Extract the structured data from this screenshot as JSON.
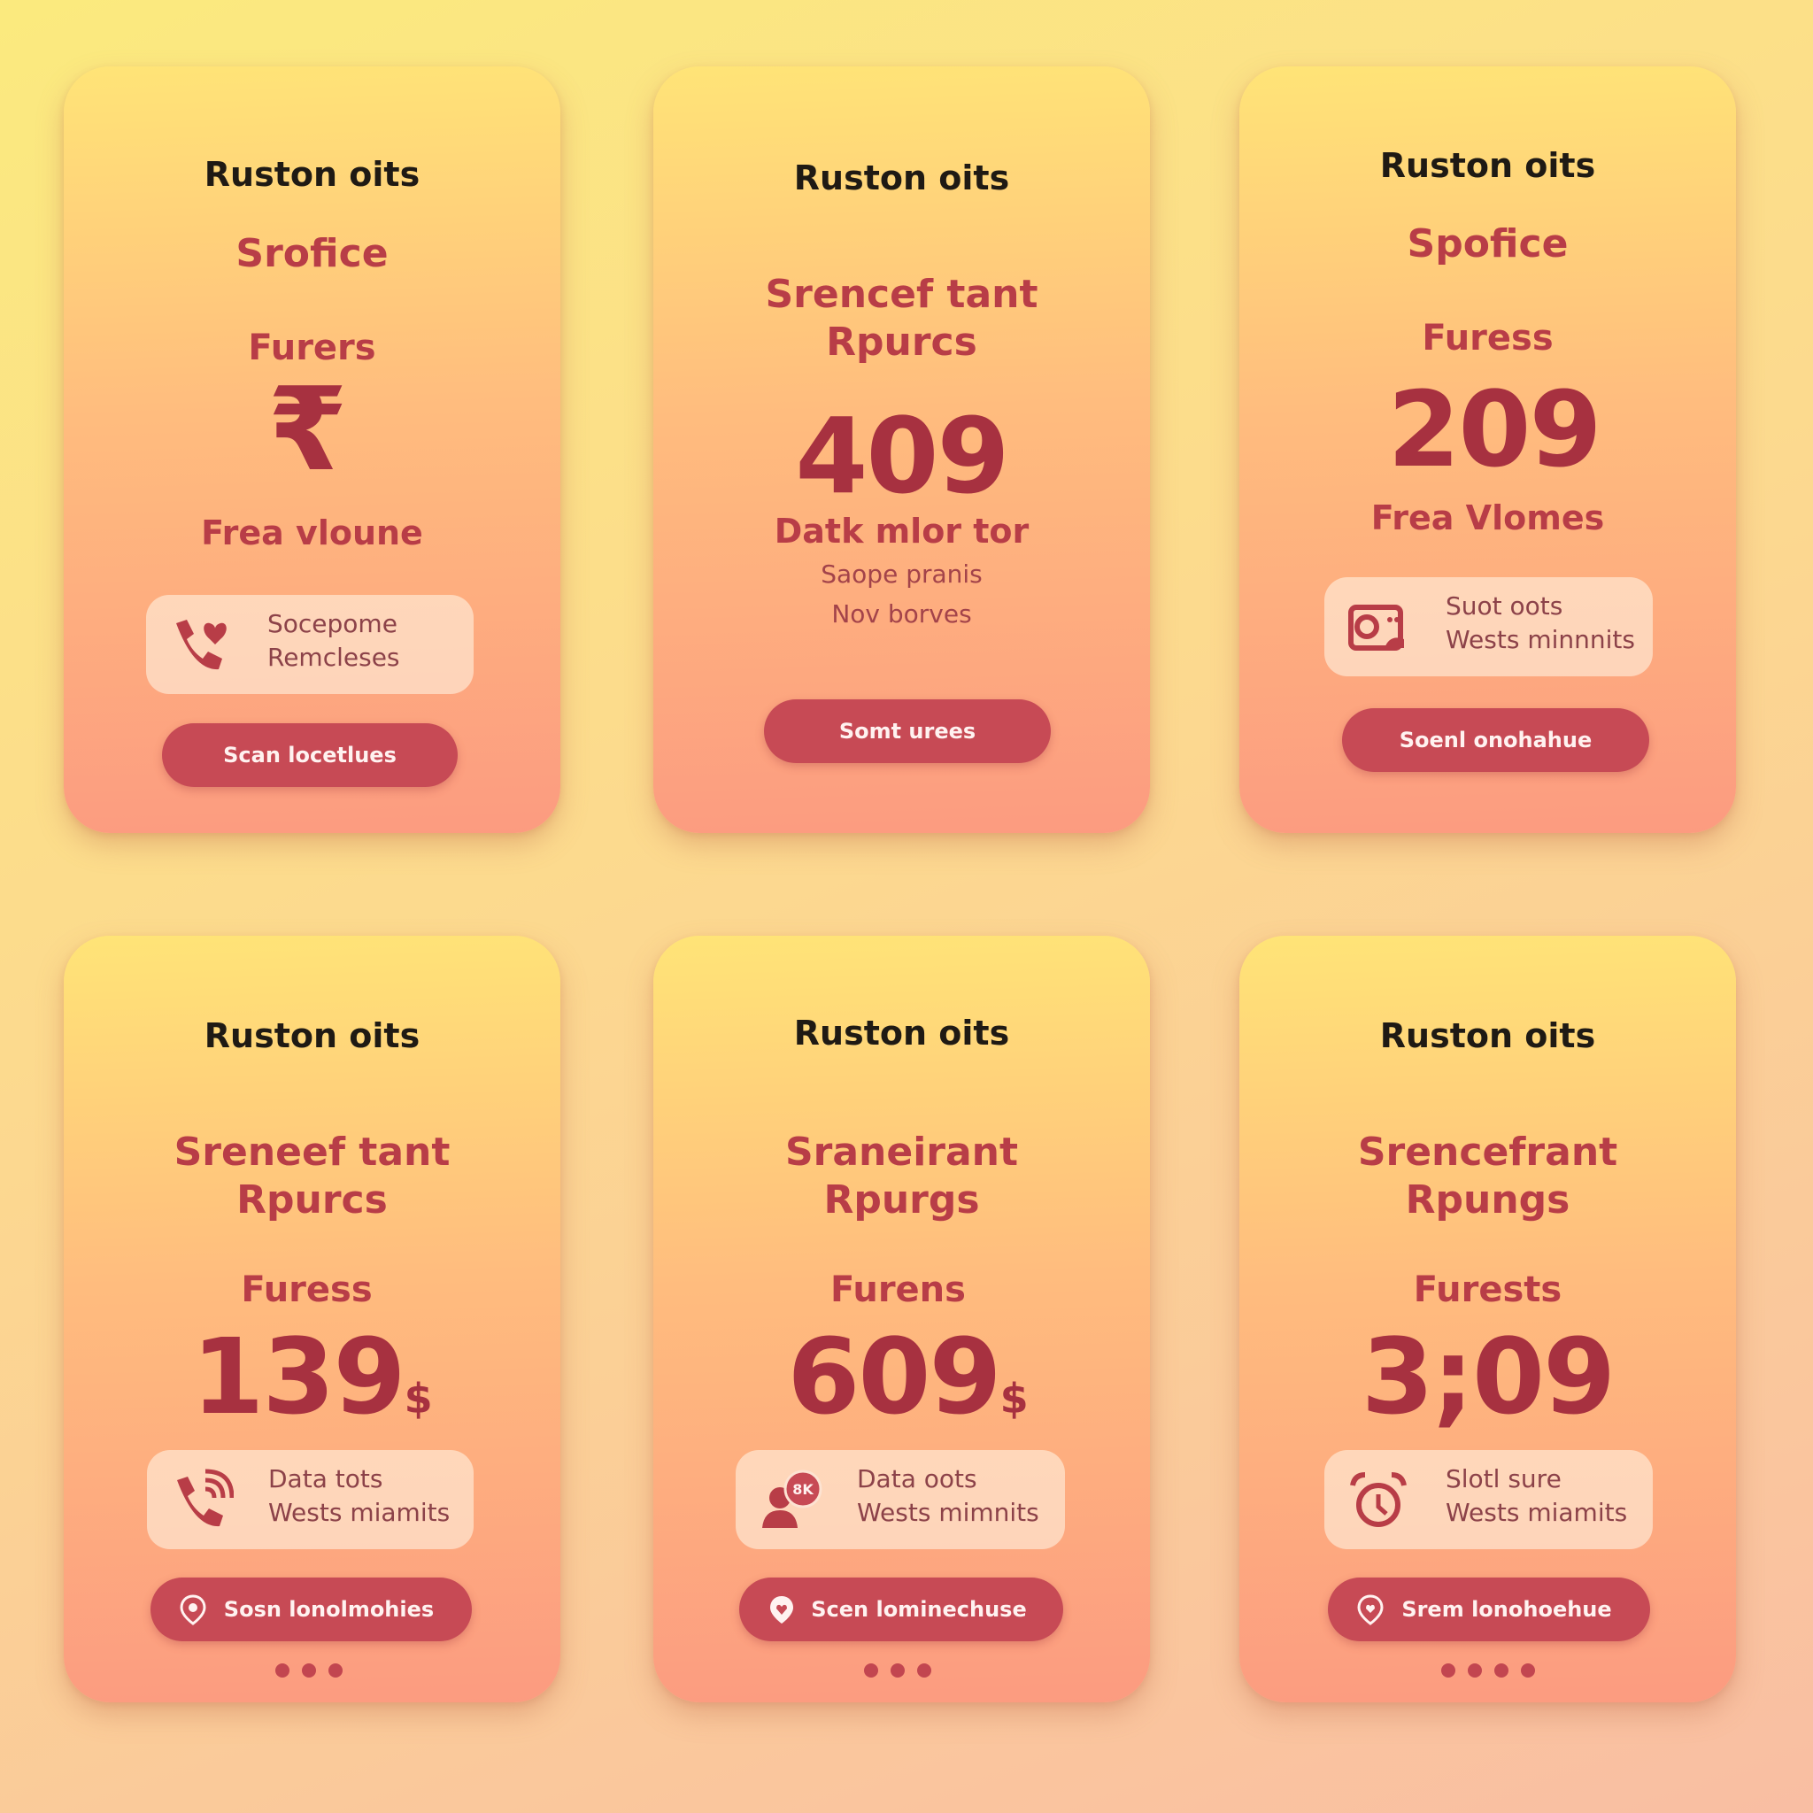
{
  "colors": {
    "accent": "#c74a55",
    "price": "#a73140",
    "title": "#1f1a14"
  },
  "cards": [
    {
      "title": "Ruston oits",
      "subtitle": "Srofice",
      "label": "Furers",
      "currency_symbol": "₹",
      "tagline": "Frea vloune",
      "feature": {
        "icon": "phone-heart-icon",
        "line1": "Socepome",
        "line2": "Remcleses"
      },
      "button": "Scan locetlues"
    },
    {
      "title": "Ruston oits",
      "subtitle": "Srencef tant\nRpurcs",
      "price": "409",
      "tagline": "Datk mlor tor",
      "note1": "Saope pranis",
      "note2": "Nov borves",
      "button": "Somt urees"
    },
    {
      "title": "Ruston oits",
      "subtitle": "Spofice",
      "label": "Furess",
      "price": "209",
      "tagline": "Frea Vlomes",
      "feature": {
        "icon": "camera-icon",
        "line1": "Suot oots",
        "line2": "Wests minnnits"
      },
      "button": "Soenl onohahue"
    },
    {
      "title": "Ruston oits",
      "subtitle": "Sreneef tant\nRpurcs",
      "label": "Furess",
      "price": "139",
      "price_suffix": "$",
      "feature": {
        "icon": "phone-ringing-icon",
        "line1": "Data tots",
        "line2": "Wests miamits"
      },
      "button": "Sosn lonolmohies",
      "dots": 3
    },
    {
      "title": "Ruston oits",
      "subtitle": "Sraneirant\nRpurgs",
      "label": "Furens",
      "price": "609",
      "price_suffix": "$",
      "feature": {
        "icon": "user-badge-icon",
        "badge": "8K",
        "line1": "Data oots",
        "line2": "Wests mimnits"
      },
      "button": "Scen lominechuse",
      "dots": 3
    },
    {
      "title": "Ruston oits",
      "subtitle": "Srencefrant\nRpungs",
      "label": "Furests",
      "price": "3;09",
      "feature": {
        "icon": "alarm-clock-icon",
        "line1": "Slotl sure",
        "line2": "Wests miamits"
      },
      "button": "Srem lonohoehue",
      "dots": 4
    }
  ]
}
